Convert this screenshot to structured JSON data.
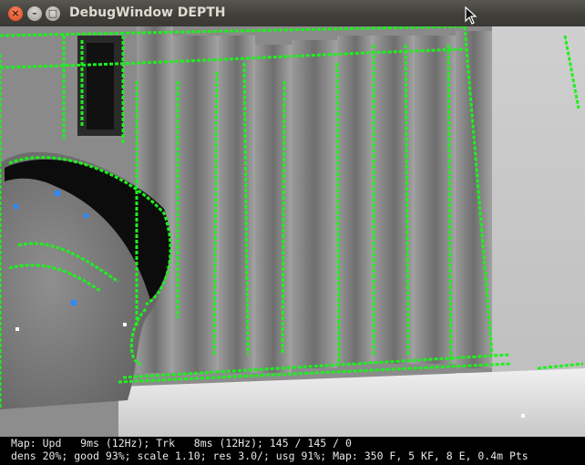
{
  "window": {
    "title": "DebugWindow DEPTH",
    "buttons": {
      "close": "×",
      "minimize": "–",
      "maximize": "□"
    }
  },
  "viewport": {
    "description_icon": "depth-camera-view",
    "colors": {
      "tracked_points": "#1ef01e",
      "highlight_points": "#2a8bff",
      "floor_plane": "#d8d8d8"
    }
  },
  "status": {
    "line1": "Map: Upd   9ms (12Hz); Trk   8ms (12Hz); 145 / 145 / 0",
    "line2": "dens 20%; good 93%; scale 1.10; res 3.0/; usg 91%; Map: 350 F, 5 KF, 8 E, 0.4m Pts"
  }
}
